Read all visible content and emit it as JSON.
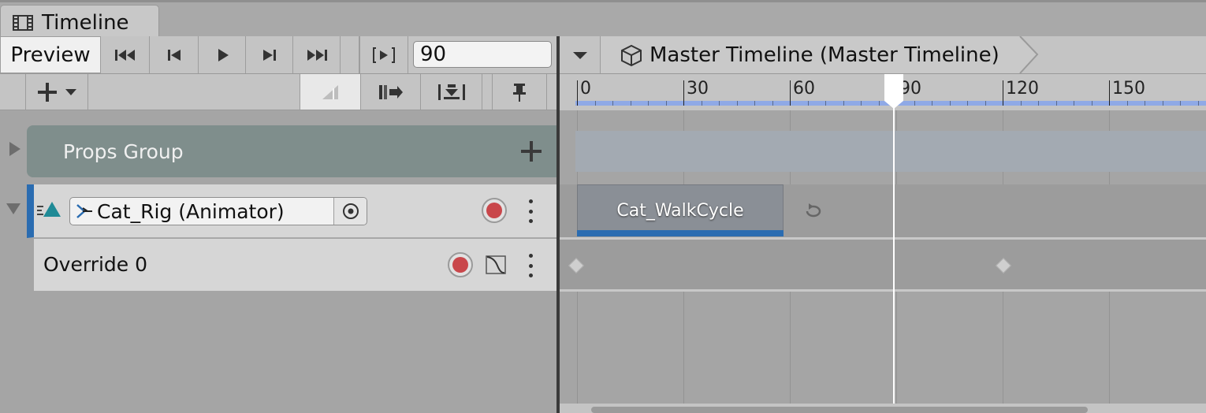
{
  "window": {
    "tab_title": "Timeline",
    "tab_icon": "film-icon"
  },
  "toolbar": {
    "preview_label": "Preview",
    "frame_value": "90",
    "buttons": [
      "go-to-start-icon",
      "previous-frame-icon",
      "play-icon",
      "next-frame-icon",
      "go-to-end-icon",
      "play-range-icon"
    ]
  },
  "breadcrumb": {
    "label": "Master Timeline (Master Timeline)",
    "icon": "cube-icon"
  },
  "ruler": {
    "labels": [
      "0",
      "30",
      "60",
      "90",
      "120",
      "150"
    ],
    "current_frame": 90,
    "colors": {
      "band": "#8fa9e6"
    }
  },
  "tracks": {
    "group": {
      "label": "Props Group"
    },
    "animation_track": {
      "binding": "Cat_Rig (Animator)",
      "accent": "#2a6cb1",
      "clip": {
        "label": "Cat_WalkCycle"
      }
    },
    "override": {
      "label": "Override 0"
    }
  },
  "colors": {
    "record": "#c9474b",
    "group_bg": "#7f8e8c",
    "track_accent": "#2a6cb1"
  }
}
